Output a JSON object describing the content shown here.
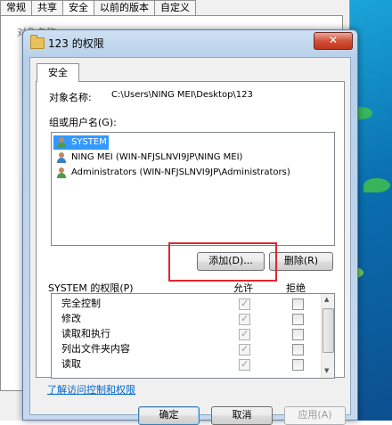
{
  "background_window": {
    "tabs": [
      "常规",
      "共享",
      "安全",
      "以前的版本",
      "自定义"
    ],
    "active_tab": 2,
    "ghost_label": "对象名称:"
  },
  "dialog": {
    "title": "123 的权限",
    "close_glyph": "✕",
    "tab_label": "安全",
    "object_name_label": "对象名称:",
    "object_name_value": "C:\\Users\\NING MEI\\Desktop\\123",
    "groups_label": "组或用户名(G):",
    "users": [
      {
        "name": "SYSTEM",
        "selected": true,
        "icon": "group-user-icon"
      },
      {
        "name": "NING MEI (WIN-NFJSLNVI9JP\\NING MEI)",
        "selected": false,
        "icon": "user-icon"
      },
      {
        "name": "Administrators (WIN-NFJSLNVI9JP\\Administrators)",
        "selected": false,
        "icon": "group-user-icon"
      }
    ],
    "add_button": "添加(D)...",
    "remove_button": "删除(R)",
    "permissions_label": "SYSTEM 的权限(P)",
    "allow_header": "允许",
    "deny_header": "拒绝",
    "permissions": [
      {
        "name": "完全控制",
        "allow": true,
        "deny": false
      },
      {
        "name": "修改",
        "allow": true,
        "deny": false
      },
      {
        "name": "读取和执行",
        "allow": true,
        "deny": false
      },
      {
        "name": "列出文件夹内容",
        "allow": true,
        "deny": false
      },
      {
        "name": "读取",
        "allow": true,
        "deny": false
      }
    ],
    "learn_link": "了解访问控制和权限",
    "ok_button": "确定",
    "cancel_button": "取消",
    "apply_button": "应用(A)"
  },
  "colors": {
    "highlight": "#e0262c",
    "selection": "#3399ff",
    "link": "#0066cc"
  }
}
